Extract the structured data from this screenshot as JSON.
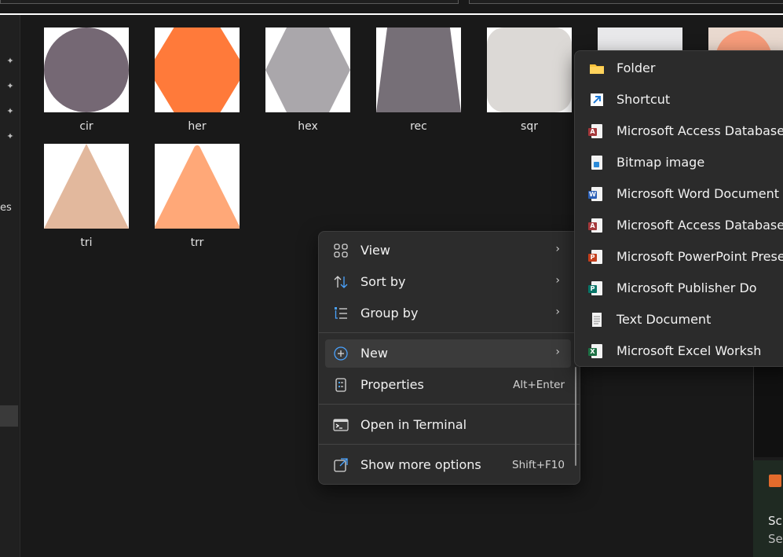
{
  "files": [
    {
      "name": "cir",
      "shape": "circle",
      "color": "#756874"
    },
    {
      "name": "her",
      "shape": "heptagon-like",
      "color": "#ff7a3a"
    },
    {
      "name": "hex",
      "shape": "hexagon",
      "color": "#aaa7ab"
    },
    {
      "name": "rec",
      "shape": "trapezoid",
      "color": "#766f77"
    },
    {
      "name": "sqr",
      "shape": "rounded-square",
      "color": "#dcd9d6"
    },
    {
      "name": "tri",
      "shape": "triangle",
      "color": "#e2b89d"
    },
    {
      "name": "trr",
      "shape": "triangle",
      "color": "#ffa878"
    }
  ],
  "nav": {
    "partial_label": "es"
  },
  "context_menu": {
    "items": [
      {
        "label": "View",
        "icon": "grid-icon",
        "submenu": true
      },
      {
        "label": "Sort by",
        "icon": "sort-icon",
        "submenu": true
      },
      {
        "label": "Group by",
        "icon": "list-icon",
        "submenu": true
      },
      {
        "label": "New",
        "icon": "plus-circle-icon",
        "submenu": true
      },
      {
        "label": "Properties",
        "icon": "properties-icon",
        "shortcut": "Alt+Enter"
      },
      {
        "label": "Open in Terminal",
        "icon": "terminal-icon"
      },
      {
        "label": "Show more options",
        "icon": "more-options-icon",
        "shortcut": "Shift+F10"
      }
    ]
  },
  "new_submenu": {
    "items": [
      {
        "label": "Folder",
        "icon": "folder-icon"
      },
      {
        "label": "Shortcut",
        "icon": "shortcut-icon"
      },
      {
        "label": "Microsoft Access Database",
        "icon": "access-icon"
      },
      {
        "label": "Bitmap image",
        "icon": "bitmap-icon"
      },
      {
        "label": "Microsoft Word Document",
        "icon": "word-icon"
      },
      {
        "label": "Microsoft Access Database",
        "icon": "access-icon"
      },
      {
        "label": "Microsoft PowerPoint Prese",
        "icon": "powerpoint-icon"
      },
      {
        "label": "Microsoft Publisher Do",
        "icon": "publisher-icon"
      },
      {
        "label": "Text Document",
        "icon": "text-document-icon"
      },
      {
        "label": "Microsoft Excel Worksh",
        "icon": "excel-icon"
      }
    ]
  },
  "background_window": {
    "line1": "Sc",
    "line2": "Se"
  },
  "colors": {
    "menu_bg": "#2c2c2c",
    "accent_blue": "#4aa3ff",
    "word_blue": "#2b5fb6",
    "access_red": "#a4373a",
    "ppt_orange": "#c43e1c",
    "publisher_teal": "#077568",
    "excel_green": "#1d7044"
  }
}
